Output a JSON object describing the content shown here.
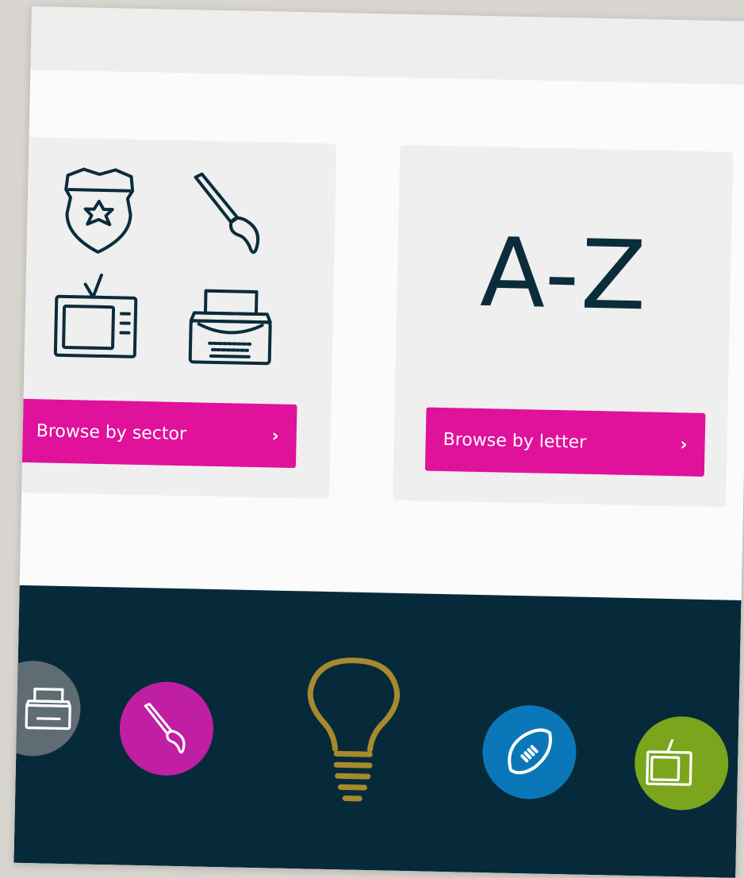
{
  "sector_card": {
    "button_label": "Browse by sector",
    "button_chevron": "›",
    "icons": [
      "police-badge-icon",
      "paintbrush-icon",
      "television-icon",
      "typewriter-icon"
    ]
  },
  "letter_card": {
    "big_text": "A-Z",
    "button_label": "Browse by letter",
    "button_chevron": "›"
  },
  "footer": {
    "icons": [
      {
        "name": "typewriter-icon",
        "color": "#5f6c74"
      },
      {
        "name": "paintbrush-icon",
        "color": "#c01fa3"
      },
      {
        "name": "lightbulb-icon",
        "color": "#a88a2e"
      },
      {
        "name": "rugby-ball-icon",
        "color": "#0a78b8"
      },
      {
        "name": "television-icon",
        "color": "#7aa51c"
      }
    ]
  },
  "colors": {
    "accent": "#e0119a",
    "navy": "#072a3a",
    "card_bg": "#efefef"
  }
}
